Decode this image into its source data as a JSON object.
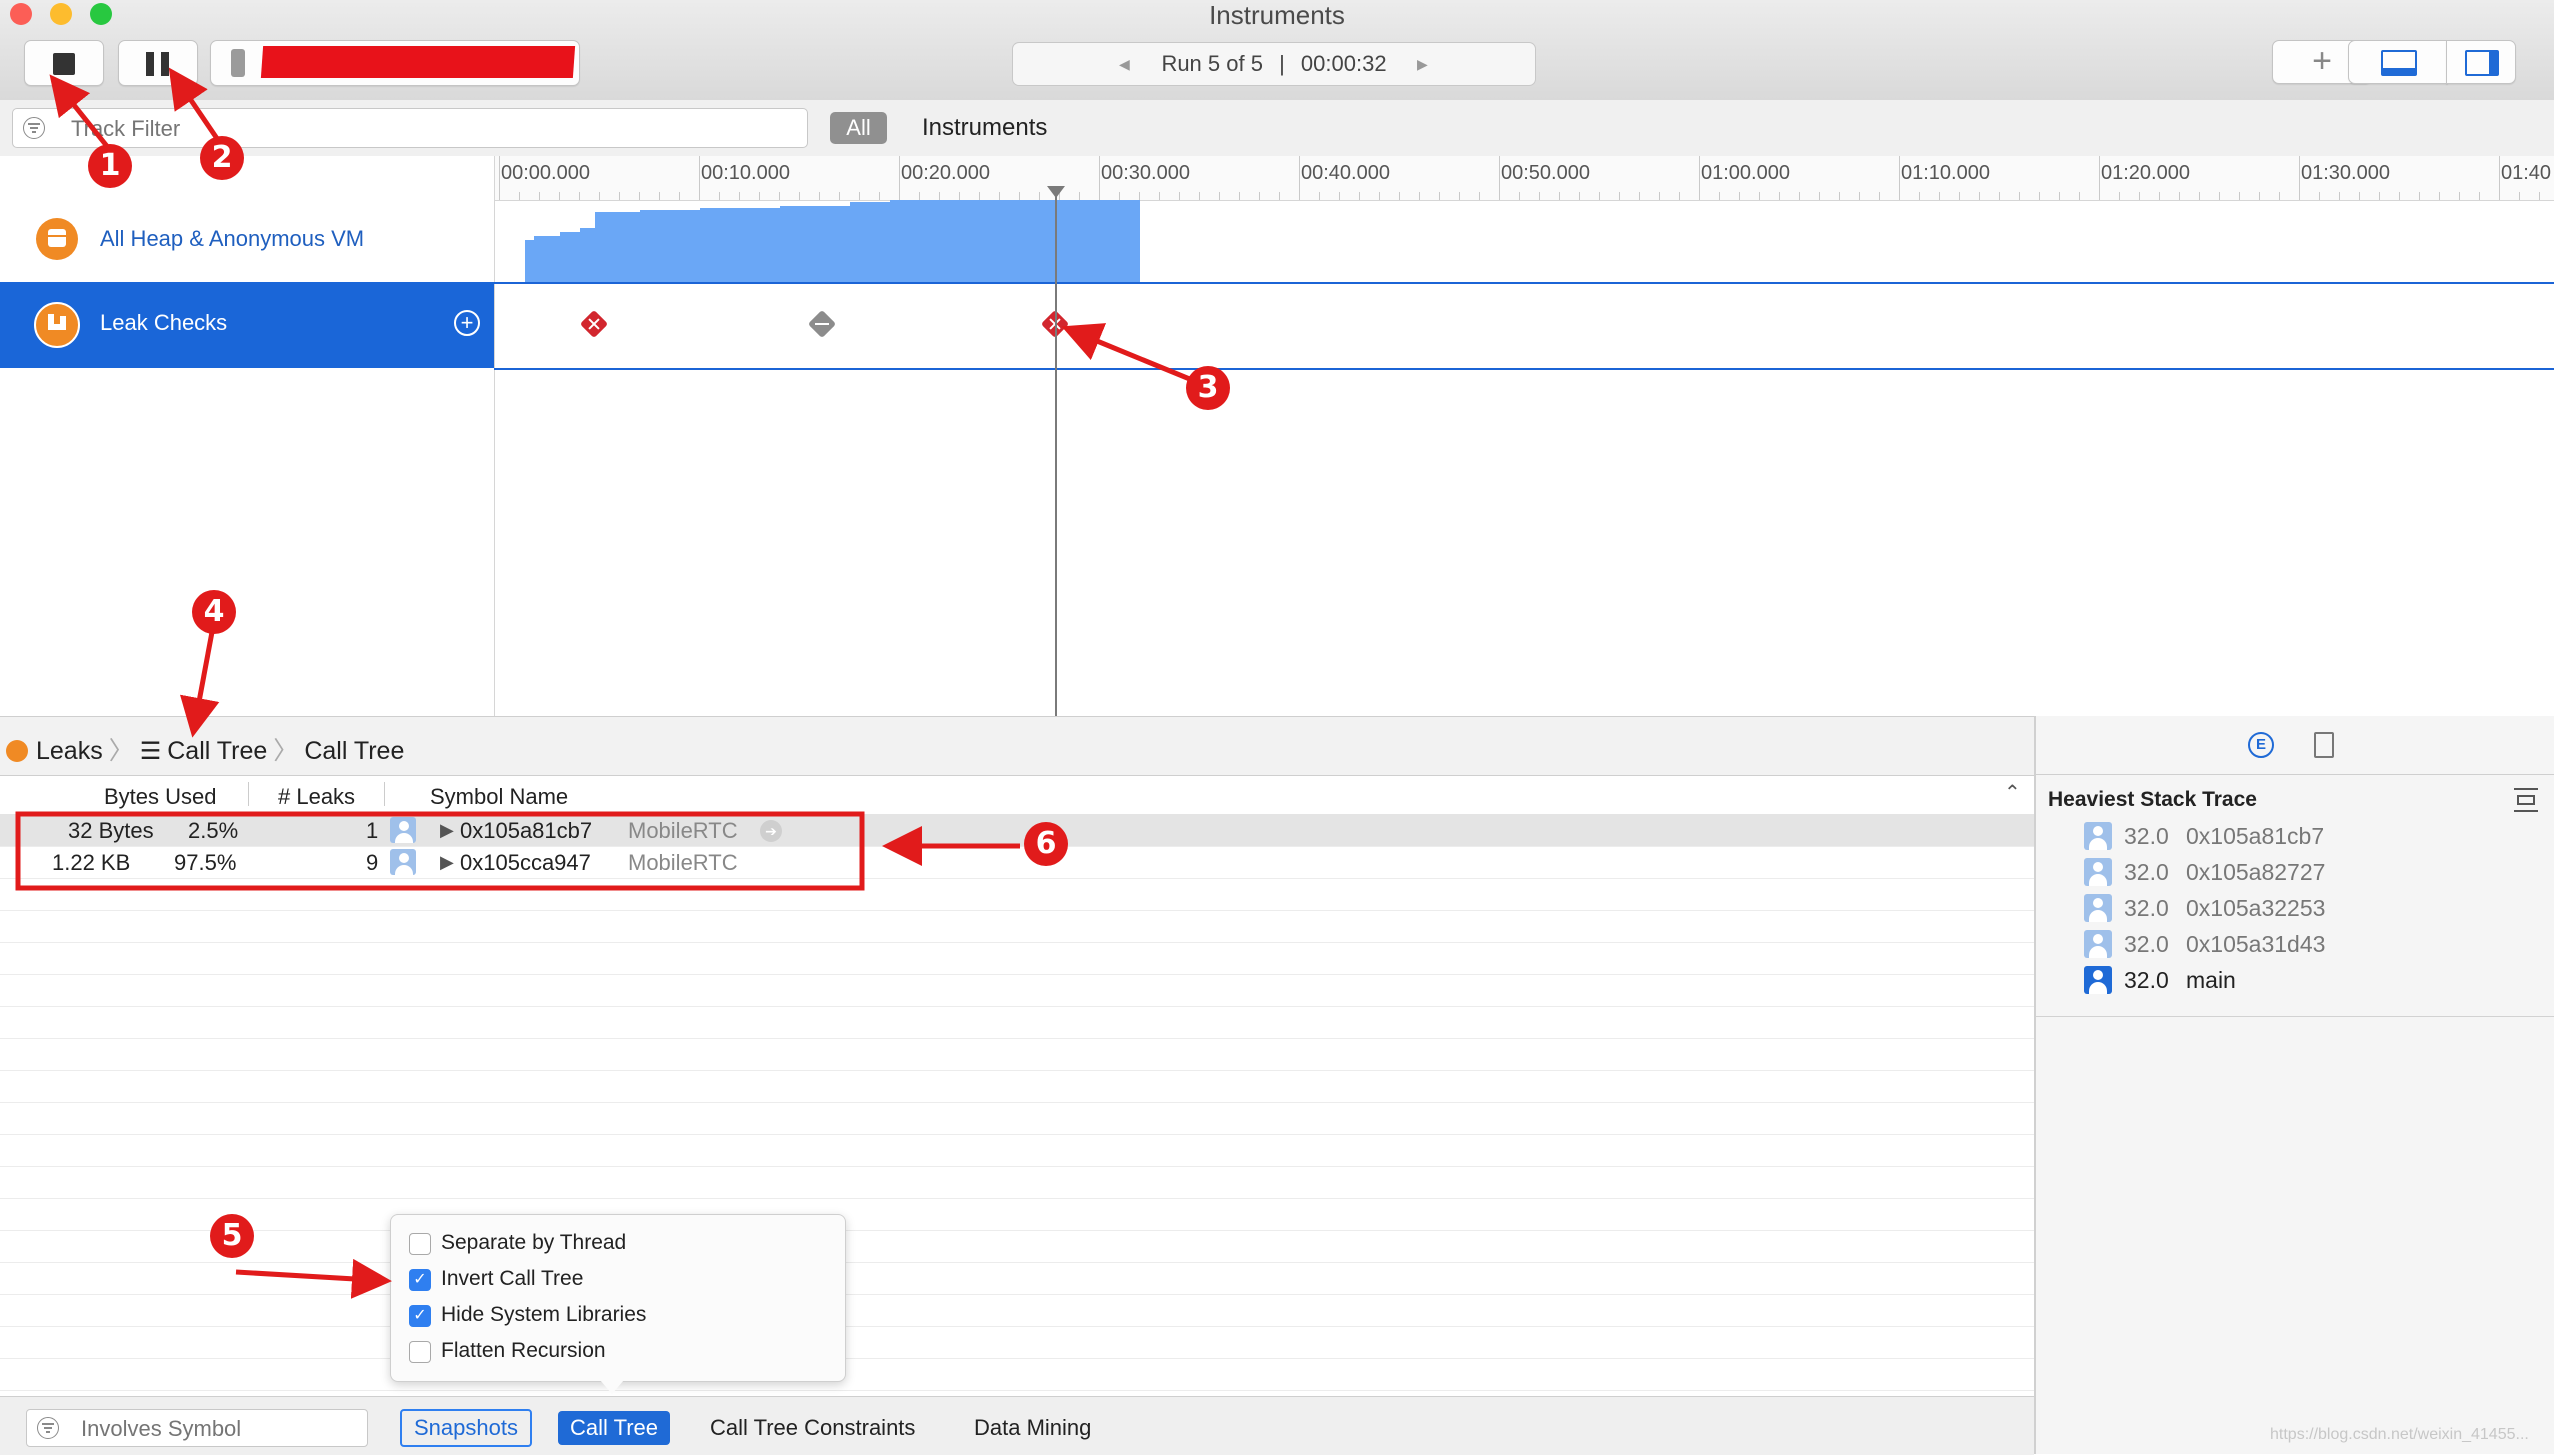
{
  "window": {
    "title": "Instruments",
    "traffic": {
      "close": "#fc5e56",
      "minimize": "#fdbc2e",
      "zoom": "#28c840"
    }
  },
  "toolbar": {
    "record_icon": "stop-icon",
    "pause_icon": "pause-icon",
    "run_label": "Run 5 of 5",
    "run_separator": "|",
    "run_time": "00:00:32",
    "prev_arrow": "◀",
    "next_arrow": "▶",
    "add_icon": "+",
    "accent": "#1f6ad6"
  },
  "filter_bar": {
    "track_filter_placeholder": "Track Filter",
    "all_label": "All",
    "instruments_label": "Instruments"
  },
  "timeline": {
    "ticks": [
      "00:00.000",
      "00:10.000",
      "00:20.000",
      "00:30.000",
      "00:40.000",
      "00:50.000",
      "01:00.000",
      "01:10.000",
      "01:20.000",
      "01:30.000",
      "01:40"
    ],
    "tracks": [
      {
        "name": "All Heap & Anonymous VM",
        "color": "#6aa7f6"
      },
      {
        "name": "Leak Checks",
        "selected": true
      }
    ]
  },
  "detail": {
    "breadcrumb": [
      "Leaks",
      "Call Tree",
      "Call Tree"
    ],
    "columns": {
      "bytes": "Bytes Used",
      "leaks": "# Leaks",
      "symbol": "Symbol Name"
    },
    "rows": [
      {
        "bytes": "32 Bytes",
        "percent": "2.5%",
        "leaks": "1",
        "symbol": "0x105a81cb7",
        "library": "MobileRTC"
      },
      {
        "bytes": "1.22 KB",
        "percent": "97.5%",
        "leaks": "9",
        "symbol": "0x105cca947",
        "library": "MobileRTC"
      }
    ]
  },
  "popup": {
    "options": [
      {
        "label": "Separate by Thread",
        "checked": false
      },
      {
        "label": "Invert Call Tree",
        "checked": true
      },
      {
        "label": "Hide System Libraries",
        "checked": true
      },
      {
        "label": "Flatten Recursion",
        "checked": false
      }
    ]
  },
  "bottom_bar": {
    "symbol_placeholder": "Involves Symbol",
    "tabs": [
      "Snapshots",
      "Call Tree",
      "Call Tree Constraints",
      "Data Mining"
    ],
    "active_tab": "Call Tree"
  },
  "stack_trace": {
    "title": "Heaviest Stack Trace",
    "frames": [
      {
        "weight": "32.0",
        "symbol": "0x105a81cb7"
      },
      {
        "weight": "32.0",
        "symbol": "0x105a82727"
      },
      {
        "weight": "32.0",
        "symbol": "0x105a32253"
      },
      {
        "weight": "32.0",
        "symbol": "0x105a31d43"
      },
      {
        "weight": "32.0",
        "symbol": "main"
      }
    ]
  },
  "annotations": [
    "1",
    "2",
    "3",
    "4",
    "5",
    "6"
  ],
  "annotation_color": "#e11b1b",
  "watermark": "https://blog.csdn.net/weixin_41455..."
}
